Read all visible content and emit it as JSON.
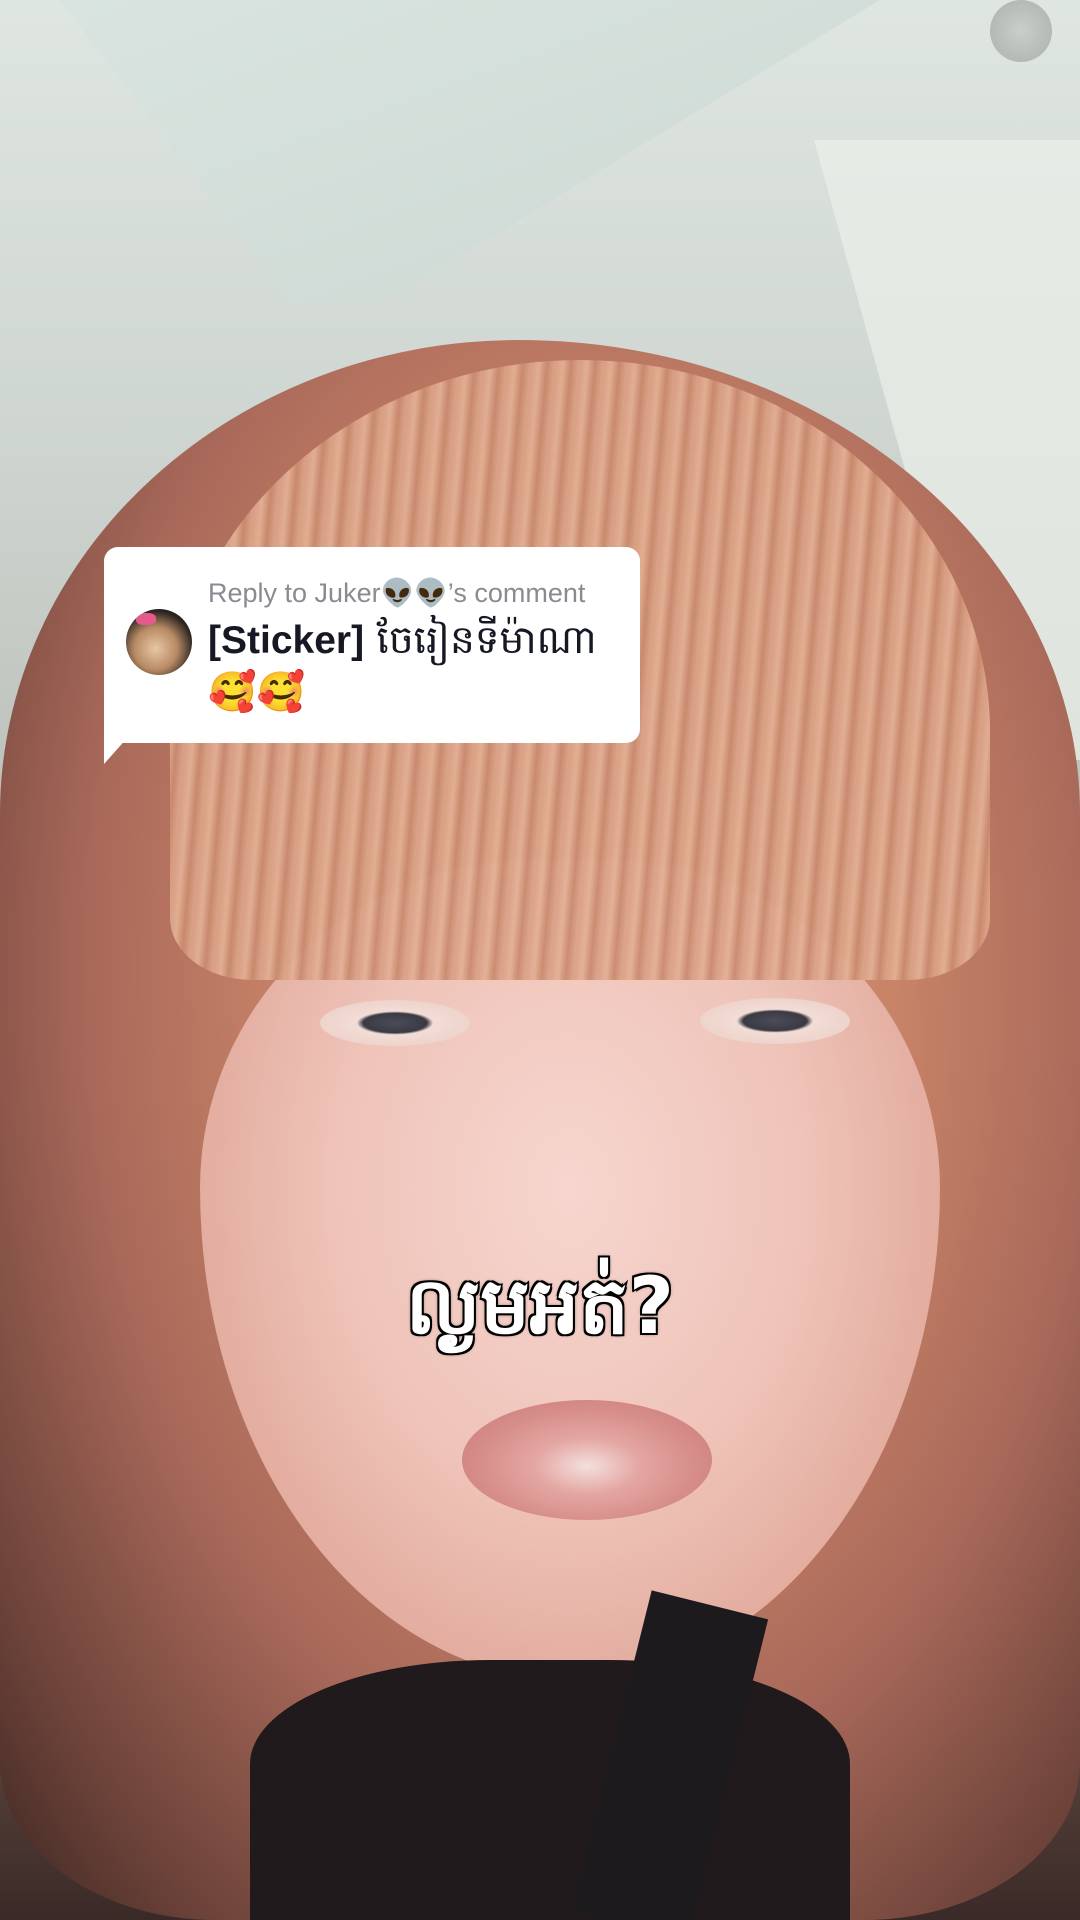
{
  "reply_card": {
    "header": "Reply to Juker👽👽’s comment",
    "sticker_tag": "[Sticker]",
    "comment_text": " ចែរៀនទីម៉ាណា🥰🥰"
  },
  "caption": {
    "text": "ល្ងមអត់?"
  },
  "colors": {
    "bubble_bg": "#ffffff",
    "header_text": "#8a8b91",
    "body_text": "#161823",
    "caption_text": "#ffffff",
    "caption_outline": "#000000"
  }
}
